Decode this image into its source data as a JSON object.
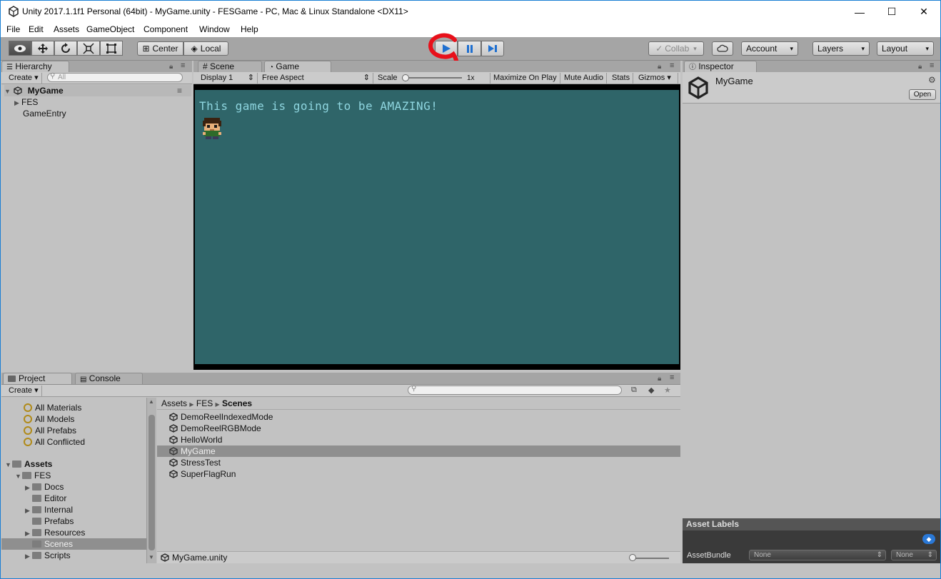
{
  "window": {
    "title": "Unity 2017.1.1f1 Personal (64bit) - MyGame.unity - FESGame - PC, Mac & Linux Standalone <DX11>",
    "minimize": "—",
    "maximize": "☐",
    "close": "✕"
  },
  "menu": [
    "File",
    "Edit",
    "Assets",
    "GameObject",
    "Component",
    "Window",
    "Help"
  ],
  "toolbar": {
    "pivot_center": "Center",
    "pivot_local": "Local",
    "collab": "Collab",
    "account": "Account",
    "layers": "Layers",
    "layout": "Layout"
  },
  "hierarchy": {
    "tab": "Hierarchy",
    "create": "Create",
    "search_placeholder": "All",
    "scene": "MyGame",
    "items": [
      "FES",
      "GameEntry"
    ]
  },
  "scene_tab": "Scene",
  "game": {
    "tab": "Game",
    "display": "Display 1",
    "aspect": "Free Aspect",
    "scale_label": "Scale",
    "scale_value": "1x",
    "maximize": "Maximize On Play",
    "mute": "Mute Audio",
    "stats": "Stats",
    "gizmos": "Gizmos",
    "message": "This game is going to be AMAZING!",
    "bg_color": "#2f6569",
    "text_color": "#8fd6e0"
  },
  "inspector": {
    "tab": "Inspector",
    "object": "MyGame",
    "open": "Open",
    "asset_labels": "Asset Labels",
    "assetbundle_label": "AssetBundle",
    "assetbundle_value": "None",
    "variant_value": "None"
  },
  "project": {
    "tab": "Project",
    "console_tab": "Console",
    "create": "Create",
    "favorites": [
      "All Materials",
      "All Models",
      "All Prefabs",
      "All Conflicted"
    ],
    "assets_root": "Assets",
    "fes": "FES",
    "fes_children": [
      "Docs",
      "Editor",
      "Internal",
      "Prefabs",
      "Resources",
      "Scenes",
      "Scripts"
    ],
    "breadcrumb": [
      "Assets",
      "FES",
      "Scenes"
    ],
    "files": [
      "DemoReelIndexedMode",
      "DemoReelRGBMode",
      "HelloWorld",
      "MyGame",
      "StressTest",
      "SuperFlagRun"
    ],
    "selected_file": "MyGame",
    "footer_file": "MyGame.unity"
  }
}
